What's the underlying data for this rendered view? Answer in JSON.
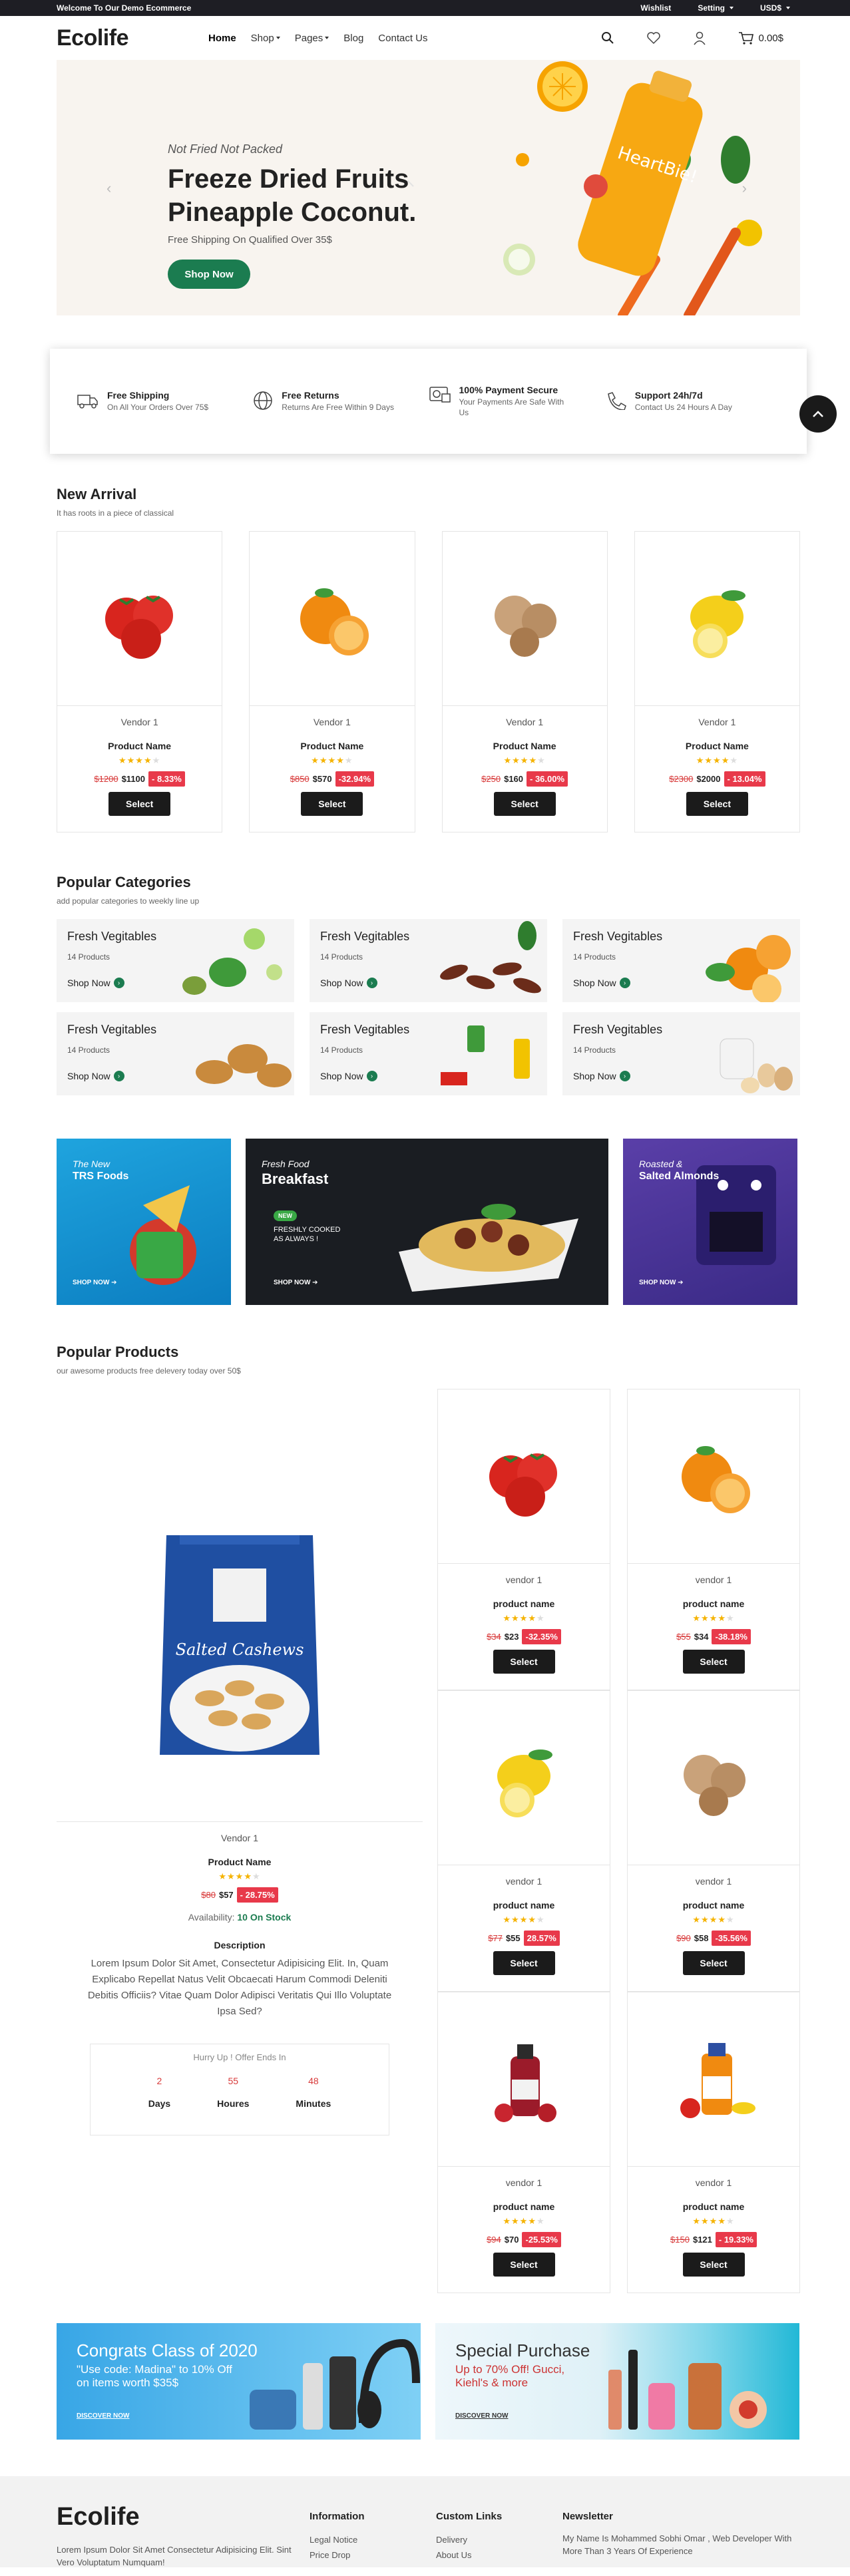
{
  "topbar": {
    "welcome": "Welcome To Our Demo Ecommerce",
    "wishlist": "Wishlist",
    "setting": "Setting",
    "currency": "USD$"
  },
  "header": {
    "logo": "Ecolife",
    "nav": [
      "Home",
      "Shop",
      "Pages",
      "Blog",
      "Contact Us"
    ],
    "cart_total": "0.00$"
  },
  "hero": {
    "subtitle": "Not Fried Not Packed",
    "title_line1": "Freeze Dried Fruits",
    "title_line2": "Pineapple Coconut.",
    "shipping": "Free Shipping On Qualified Over 35$",
    "button": "Shop Now",
    "bottle_brand": "HeartBie!"
  },
  "features": [
    {
      "title": "Free Shipping",
      "desc": "On All Your Orders Over 75$",
      "icon": "truck-icon"
    },
    {
      "title": "Free Returns",
      "desc": "Returns Are Free Within 9 Days",
      "icon": "globe-icon"
    },
    {
      "title": "100% Payment Secure",
      "desc": "Your Payments Are Safe With Us",
      "icon": "payment-icon"
    },
    {
      "title": "Support 24h/7d",
      "desc": "Contact Us 24 Hours A Day",
      "icon": "support-icon"
    }
  ],
  "new_arrival": {
    "title": "New Arrival",
    "subtitle": "It has roots in a piece of classical",
    "products": [
      {
        "vendor": "Vendor 1",
        "name": "Product Name",
        "rating": 4,
        "old": "$1200",
        "new": "$1100",
        "discount": "- 8.33%",
        "image": "tomato"
      },
      {
        "vendor": "Vendor 1",
        "name": "Product Name",
        "rating": 4,
        "old": "$850",
        "new": "$570",
        "discount": "-32.94%",
        "image": "orange"
      },
      {
        "vendor": "Vendor 1",
        "name": "Product Name",
        "rating": 4,
        "old": "$250",
        "new": "$160",
        "discount": "- 36.00%",
        "image": "walnut"
      },
      {
        "vendor": "Vendor 1",
        "name": "Product Name",
        "rating": 4,
        "old": "$2300",
        "new": "$2000",
        "discount": "- 13.04%",
        "image": "lemon"
      }
    ],
    "select_label": "Select"
  },
  "categories": {
    "title": "Popular Categories",
    "subtitle": "add popular categories to weekly line up",
    "items": [
      {
        "name": "Fresh Vegitables",
        "count": "14 Products",
        "shop": "Shop Now"
      },
      {
        "name": "Fresh Vegitables",
        "count": "14 Products",
        "shop": "Shop Now"
      },
      {
        "name": "Fresh Vegitables",
        "count": "14 Products",
        "shop": "Shop Now"
      },
      {
        "name": "Fresh Vegitables",
        "count": "14 Products",
        "shop": "Shop Now"
      },
      {
        "name": "Fresh Vegitables",
        "count": "14 Products",
        "shop": "Shop Now"
      },
      {
        "name": "Fresh Vegitables",
        "count": "14 Products",
        "shop": "Shop Now"
      }
    ]
  },
  "banners": [
    {
      "line1": "The New",
      "line2": "TRS Foods",
      "shop": "SHOP NOW"
    },
    {
      "line1": "Fresh Food",
      "line2": "Breakfast",
      "badge": "NEW",
      "tag": "FRESHLY COOKED AS ALWAYS !",
      "shop": "SHOP NOW"
    },
    {
      "line1": "Roasted &",
      "line2": "Salted Almonds",
      "shop": "SHOP NOW"
    }
  ],
  "popular_products": {
    "title": "Popular Products",
    "subtitle": "our awesome products free delevery today over 50$",
    "featured": {
      "pack_label": "Salted Cashews",
      "vendor": "Vendor 1",
      "name": "Product Name",
      "rating": 4,
      "old": "$80",
      "new": "$57",
      "discount": "- 28.75%",
      "availability_label": "Availability:",
      "availability_value": "10 On Stock",
      "description_title": "Description",
      "description": "Lorem Ipsum Dolor Sit Amet, Consectetur Adipisicing Elit. In, Quam Explicabo Repellat Natus Velit Obcaecati Harum Commodi Deleniti Debitis Officiis? Vitae Quam Dolor Adipisci Veritatis Qui Illo Voluptate Ipsa Sed?",
      "countdown_title": "Hurry Up ! Offer Ends In",
      "days": "2",
      "days_label": "Days",
      "hours": "55",
      "hours_label": "Houres",
      "minutes": "48",
      "minutes_label": "Minutes"
    },
    "products": [
      {
        "vendor": "vendor 1",
        "name": "product name",
        "rating": 4,
        "old": "$34",
        "new": "$23",
        "discount": "-32.35%",
        "image": "tomato"
      },
      {
        "vendor": "vendor 1",
        "name": "product name",
        "rating": 4,
        "old": "$55",
        "new": "$34",
        "discount": "-38.18%",
        "image": "orange"
      },
      {
        "vendor": "vendor 1",
        "name": "product name",
        "rating": 4,
        "old": "$77",
        "new": "$55",
        "discount": "28.57%",
        "image": "lemon"
      },
      {
        "vendor": "vendor 1",
        "name": "product name",
        "rating": 4,
        "old": "$90",
        "new": "$58",
        "discount": "-35.56%",
        "image": "walnut"
      },
      {
        "vendor": "vendor 1",
        "name": "product name",
        "rating": 4,
        "old": "$94",
        "new": "$70",
        "discount": "-25.53%",
        "image": "juice"
      },
      {
        "vendor": "vendor 1",
        "name": "product name",
        "rating": 4,
        "old": "$150",
        "new": "$121",
        "discount": "- 19.33%",
        "image": "fruitjuice"
      }
    ],
    "select_label": "Select"
  },
  "promos": [
    {
      "title": "Congrats Class of 2020",
      "text": "\"Use code: Madina\" to 10% Off on items worth $35$",
      "link": "DISCOVER NOW"
    },
    {
      "title": "Special Purchase",
      "text": "Up to 70% Off! Gucci, Kiehl's & more",
      "link": "DISCOVER NOW"
    }
  ],
  "footer": {
    "logo": "Ecolife",
    "text": "Lorem Ipsum Dolor Sit Amet Consectetur Adipisicing Elit. Sint Vero Voluptatum Numquam!",
    "columns": [
      {
        "heading": "Information",
        "links": [
          "Legal Notice",
          "Price Drop"
        ]
      },
      {
        "heading": "Custom Links",
        "links": [
          "Delivery",
          "About Us"
        ]
      },
      {
        "heading": "Newsletter",
        "links": [
          "My Name Is Mohammed Sobhi Omar , Web Developer With More Than 3 Years Of Experience"
        ]
      }
    ]
  },
  "colors": {
    "brand_green": "#1b7c50",
    "discount_red": "#e8394a",
    "dark": "#1b1b1b"
  }
}
